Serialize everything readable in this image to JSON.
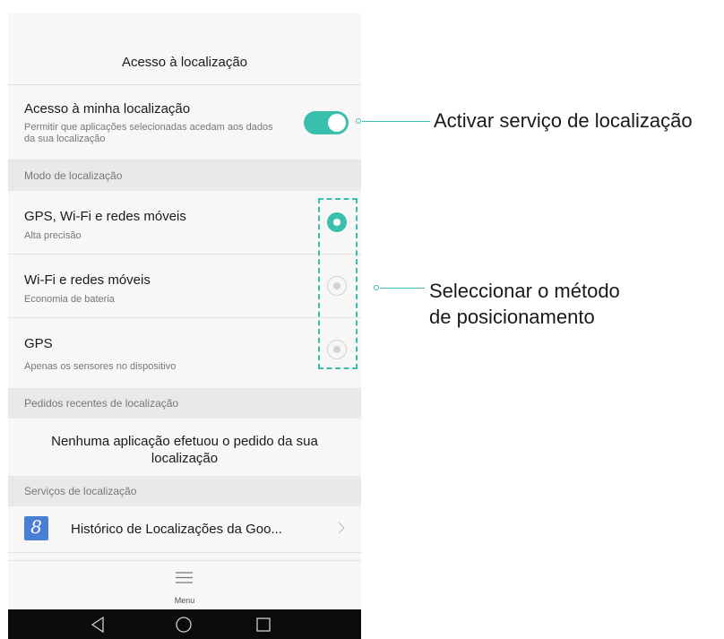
{
  "screen": {
    "title": "Acesso à localização",
    "location_access": {
      "label": "Acesso à minha localização",
      "description": "Permitir que aplicações selecionadas acedam aos dados da sua localização",
      "enabled": true
    },
    "mode_section": "Modo de localização",
    "modes": [
      {
        "title": "GPS, Wi-Fi e redes móveis",
        "subtitle": "Alta precisão",
        "selected": true
      },
      {
        "title": "Wi-Fi e redes móveis",
        "subtitle": "Economia de bateria",
        "selected": false
      },
      {
        "title": "GPS",
        "subtitle": "Apenas os sensores no dispositivo",
        "selected": false
      }
    ],
    "recent_section": "Pedidos recentes de localização",
    "recent_empty": "Nenhuma aplicação efetuou o pedido da sua localização",
    "services_section": "Serviços de localização",
    "google_history": {
      "icon": "google-g-icon",
      "logo_letter": "8",
      "label": "Histórico de Localizações da Goo..."
    },
    "menu_label": "Menu"
  },
  "annotations": {
    "activate": "Activar serviço de localização",
    "select_line1": "Seleccionar o método",
    "select_line2": "de posicionamento"
  },
  "colors": {
    "accent": "#3bbfad",
    "google_blue": "#4a7fd6",
    "navbar": "#0b0b0b"
  }
}
